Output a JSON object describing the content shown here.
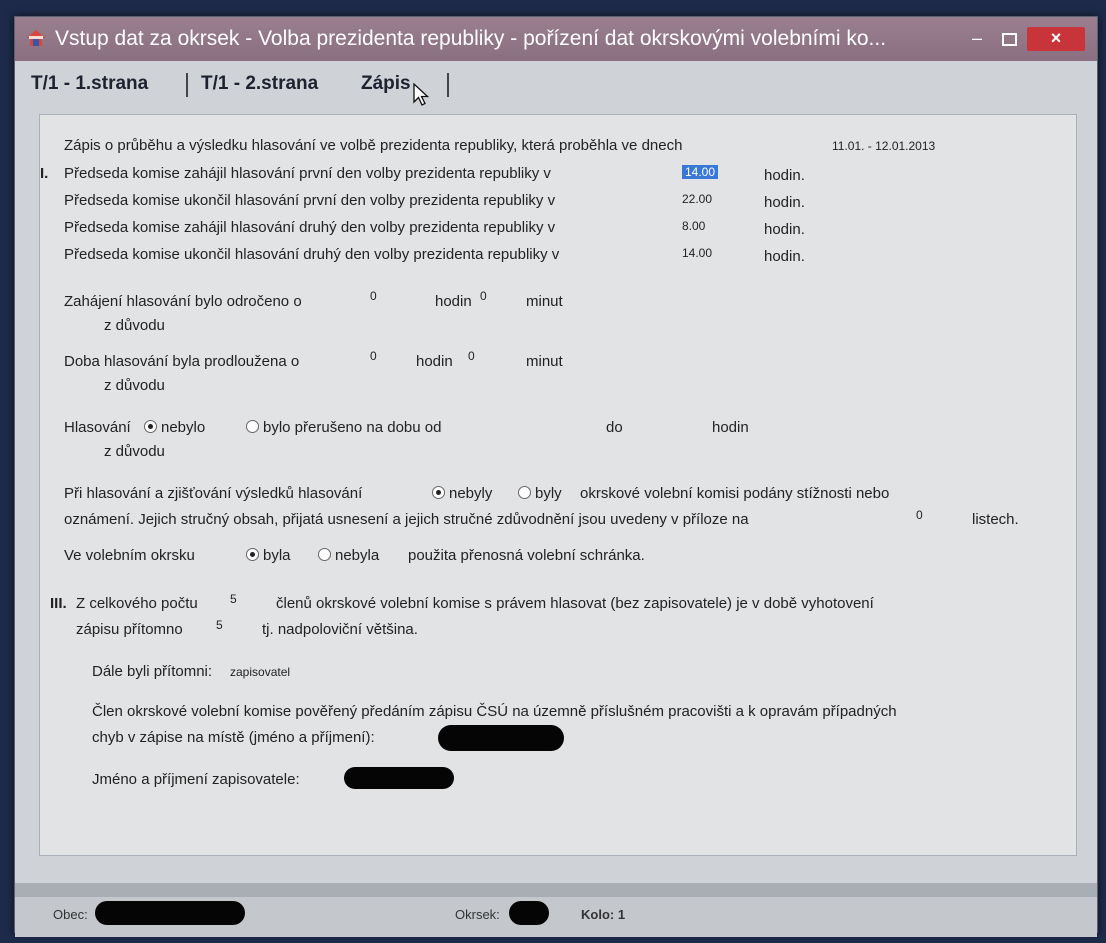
{
  "window": {
    "title": "Vstup dat za okrsek - Volba prezidenta republiky - pořízení dat okrskovými volebními ko...",
    "min_label": "–",
    "close_label": "×"
  },
  "tabs": [
    {
      "label": "T/1 - 1.strana"
    },
    {
      "label": "T/1 - 2.strana"
    },
    {
      "label": "Zápis"
    }
  ],
  "form": {
    "intro": "Zápis o průběhu a výsledku hlasování ve volbě prezidenta republiky, která proběhla ve dnech",
    "dates": "11.01. - 12.01.2013",
    "section1": "I.",
    "row1": "Předseda komise zahájil hlasování první den volby prezidenta republiky v",
    "row1_val": "14.00",
    "row2": "Předseda komise ukončil hlasování první den volby prezidenta republiky v",
    "row2_val": "22.00",
    "row3": "Předseda komise zahájil hlasování druhý den volby prezidenta republiky v",
    "row3_val": "8.00",
    "row4": "Předseda komise ukončil hlasování druhý den volby prezidenta republiky v",
    "row4_val": "14.00",
    "hodin_dot": "hodin.",
    "delay_label": "Zahájení hlasování bylo odročeno o",
    "delay_h": "0",
    "delay_m": "0",
    "hodin": "hodin",
    "minut": "minut",
    "reason": "z důvodu",
    "extend_label": "Doba hlasování byla prodloužena o",
    "extend_h": "0",
    "extend_m": "0",
    "interrupt_label": "Hlasování",
    "interrupt_opt1": "nebylo",
    "interrupt_opt2": "bylo přerušeno na dobu od",
    "do": "do",
    "complaints_prefix": "Při hlasování a zjišťování výsledků hlasování",
    "complaints_opt1": "nebyly",
    "complaints_opt2": "byly",
    "complaints_suffix": "okrskové volební komisi podány stížnosti nebo",
    "complaints_line2": "oznámení. Jejich stručný obsah, přijatá usnesení a jejich stručné zdůvodnění jsou uvedeny v příloze na",
    "complaints_sheets": "0",
    "listech": "listech.",
    "box_prefix": "Ve volebním okrsku",
    "box_opt1": "byla",
    "box_opt2": "nebyla",
    "box_suffix": "použita přenosná volební schránka.",
    "section3": "III.",
    "members_prefix": "Z celkového počtu",
    "members_total": "5",
    "members_suffix": "členů okrskové volební komise s právem hlasovat (bez zapisovatele) je v době vyhotovení",
    "present_prefix": "zápisu přítomno",
    "present_count": "5",
    "present_suffix": "tj. nadpoloviční většina.",
    "others_label": "Dále byli přítomni:",
    "others_value": "zapisovatel",
    "member_line1": "Člen okrskové volební komise pověřený předáním zápisu ČSÚ na územně příslušném pracovišti a k opravám případných",
    "member_line2": "chyb v zápise na místě (jméno a příjmení):",
    "recorder_label": "Jméno a příjmení zapisovatele:"
  },
  "status": {
    "obec_label": "Obec:",
    "okrsek_label": "Okrsek:",
    "kolo": "Kolo: 1"
  }
}
